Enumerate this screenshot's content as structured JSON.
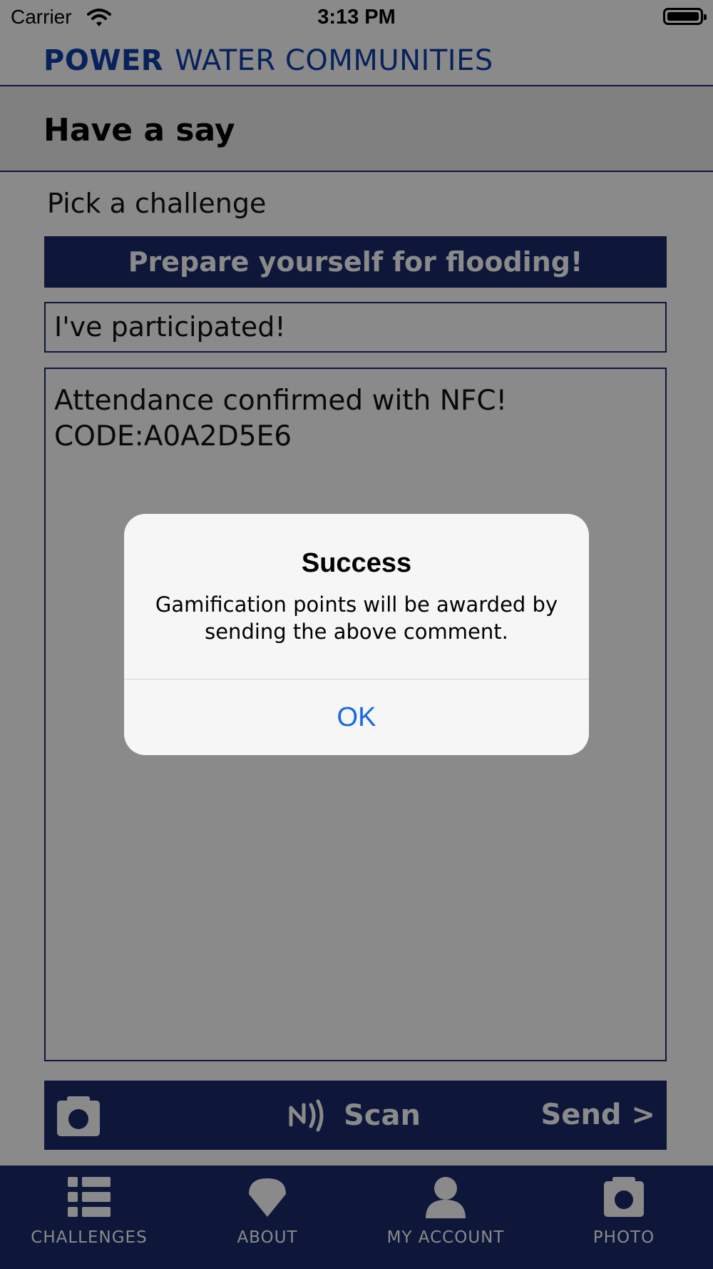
{
  "status_bar": {
    "carrier": "Carrier",
    "time": "3:13 PM",
    "wifi_icon": "wifi-icon",
    "battery_icon": "battery-icon"
  },
  "header": {
    "brand_strong": "POWER",
    "brand_rest": "WATER COMMUNITIES",
    "brand_color": "#0d3fa8"
  },
  "section": {
    "title": "Have a say"
  },
  "form": {
    "pick_label": "Pick a challenge",
    "challenge": "Prepare yourself for flooding!",
    "participation": "I've participated!",
    "comment_lines": [
      "Attendance confirmed with NFC!",
      "CODE:A0A2D5E6"
    ]
  },
  "actions": {
    "camera_icon": "camera-icon",
    "nfc_icon": "nfc-icon",
    "scan_label": "Scan",
    "send_label": "Send >"
  },
  "tabs": [
    {
      "label": "CHALLENGES",
      "icon": "list-icon"
    },
    {
      "label": "ABOUT",
      "icon": "drop-icon"
    },
    {
      "label": "MY ACCOUNT",
      "icon": "user-icon"
    },
    {
      "label": "PHOTO",
      "icon": "camera-icon"
    }
  ],
  "alert": {
    "title": "Success",
    "message": "Gamification points will be awarded by sending the above comment.",
    "ok_label": "OK"
  },
  "colors": {
    "primary": "#1a2a6c",
    "alert_button": "#1667e3",
    "band": "#ededed"
  }
}
